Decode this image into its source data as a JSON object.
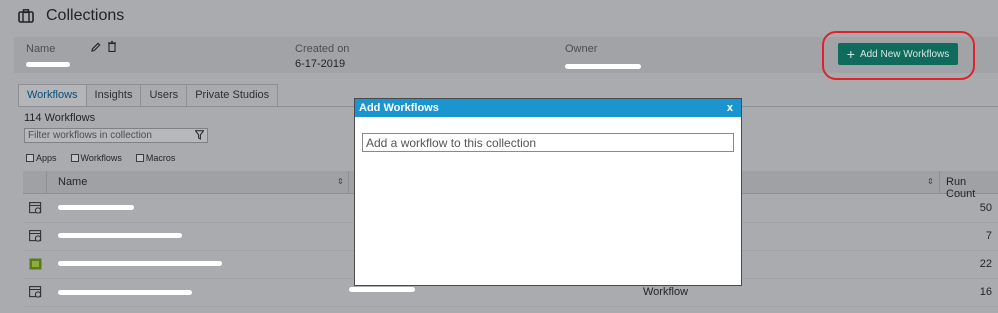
{
  "page": {
    "title": "Collections",
    "name_label": "Name",
    "created_label": "Created on",
    "created_value": "6-17-2019",
    "owner_label": "Owner",
    "add_button_label": "Add New Workflows"
  },
  "tabs": [
    {
      "label": "Workflows"
    },
    {
      "label": "Insights"
    },
    {
      "label": "Users"
    },
    {
      "label": "Private Studios"
    }
  ],
  "list": {
    "count_label": "114 Workflows",
    "filter_placeholder": "Filter workflows in collection",
    "checkboxes": [
      {
        "label": "Apps"
      },
      {
        "label": "Workflows"
      },
      {
        "label": "Macros"
      }
    ]
  },
  "table": {
    "headers": {
      "name": "Name",
      "run_count": "Run Count"
    },
    "rows": [
      {
        "run_count": "50",
        "type": ""
      },
      {
        "run_count": "7",
        "type": ""
      },
      {
        "run_count": "22",
        "type": ""
      },
      {
        "run_count": "16",
        "type": "Workflow"
      }
    ]
  },
  "modal": {
    "title": "Add Workflows",
    "close_label": "x",
    "input_placeholder": "Add a workflow to this collection"
  },
  "colors": {
    "accent_button": "#0f6b5c",
    "modal_header": "#1a95cf",
    "highlight_ring": "#e2222a"
  }
}
